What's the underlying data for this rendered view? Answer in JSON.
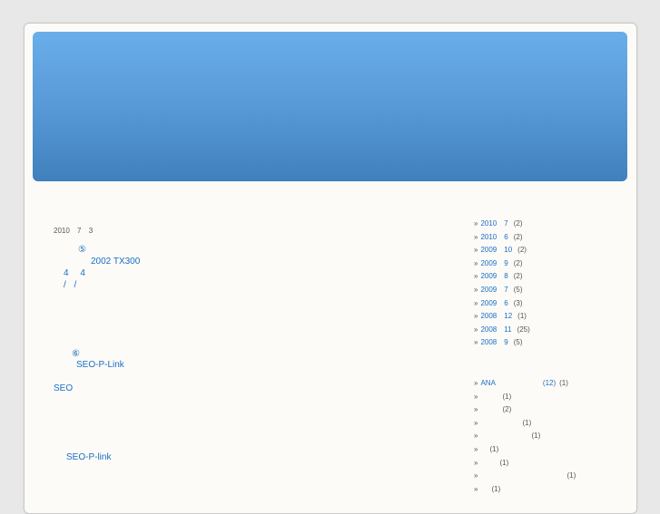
{
  "post": {
    "date": "2010 7 3",
    "line1_glyph": "⑤",
    "line2": "2002 TX300",
    "line3": "4 4",
    "line4": "/ /",
    "line5_glyph": "⑥",
    "line6": "SEO-P-Link",
    "line7": "SEO",
    "line8": "SEO-P-link"
  },
  "archives": [
    {
      "year": "2010",
      "month": "7",
      "count": "(2)"
    },
    {
      "year": "2010",
      "month": "6",
      "count": "(2)"
    },
    {
      "year": "2009",
      "month": "10",
      "count": "(2)"
    },
    {
      "year": "2009",
      "month": "9",
      "count": "(2)"
    },
    {
      "year": "2009",
      "month": "8",
      "count": "(2)"
    },
    {
      "year": "2009",
      "month": "7",
      "count": "(5)"
    },
    {
      "year": "2009",
      "month": "6",
      "count": "(3)"
    },
    {
      "year": "2008",
      "month": "12",
      "count": "(1)"
    },
    {
      "year": "2008",
      "month": "11",
      "count": "(25)"
    },
    {
      "year": "2008",
      "month": "9",
      "count": "(5)"
    }
  ],
  "categories": [
    {
      "label": "ANA",
      "extra": "(12)",
      "count": "(1)"
    },
    {
      "label": "",
      "extra": "",
      "count": "(1)"
    },
    {
      "label": "",
      "extra": "",
      "count": "(2)"
    },
    {
      "label": "",
      "extra": "",
      "count": "(1)"
    },
    {
      "label": "",
      "extra": "",
      "count": "(1)"
    },
    {
      "label": "",
      "extra": "",
      "count": "(1)"
    },
    {
      "label": "",
      "extra": "",
      "count": "(1)"
    },
    {
      "label": "",
      "extra": "",
      "count": "(1)"
    },
    {
      "label": "",
      "extra": "",
      "count": "(1)"
    }
  ],
  "bullet": "»",
  "colors": {
    "page_bg": "#e8e8e8",
    "card_bg": "#fdfbf7",
    "banner_top": "#69aeea",
    "banner_bottom": "#3f80bd",
    "link": "#1a6ec4"
  }
}
